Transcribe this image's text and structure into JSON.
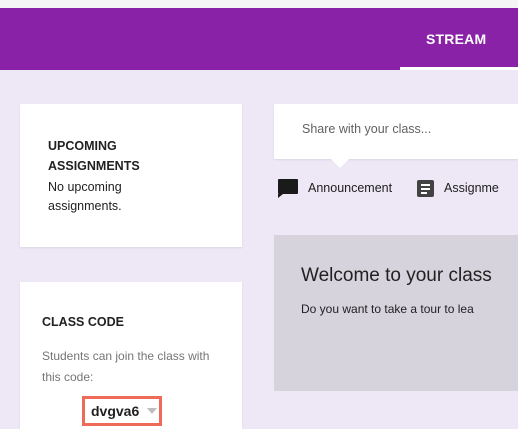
{
  "header": {
    "tabs": [
      {
        "label": "STREAM",
        "active": true
      }
    ],
    "brand_color": "#8a22a8"
  },
  "upcoming": {
    "title": "UPCOMING ASSIGNMENTS",
    "message": "No upcoming assignments."
  },
  "class_code": {
    "title": "CLASS CODE",
    "description": "Students can join the class with this code:",
    "code": "dvgva6",
    "highlight_color": "#ee6b59"
  },
  "share": {
    "placeholder": "Share with your class..."
  },
  "post_types": [
    {
      "label": "Announcement",
      "icon": "announcement-icon"
    },
    {
      "label": "Assignme",
      "icon": "assignment-icon"
    }
  ],
  "welcome": {
    "title": "Welcome to your class",
    "subtitle": "Do you want to take a tour to lea"
  }
}
